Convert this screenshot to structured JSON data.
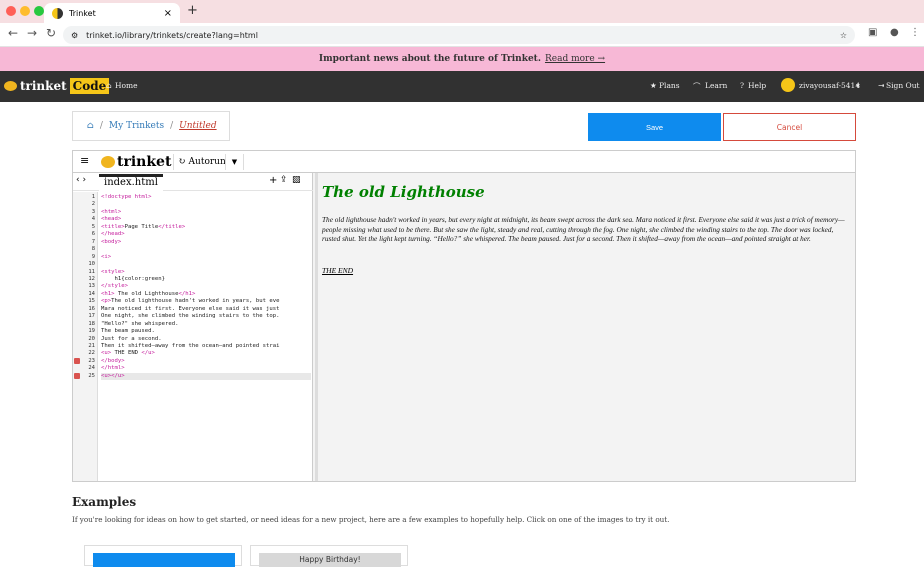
{
  "browser": {
    "tab_title": "Trinket",
    "new_tab_icon": "+",
    "url": "trinket.io/library/trinkets/create?lang=html",
    "traffic_lights": [
      "#ff5f57",
      "#febc2e",
      "#28c840"
    ]
  },
  "banner": {
    "text": "Important news about the future of Trinket.",
    "link": "Read more →"
  },
  "topnav": {
    "brand": "trinket",
    "brand_badge": "Code",
    "home": "Home",
    "plans": "Plans",
    "learn": "Learn",
    "help": "Help",
    "user": "zivayousaf-5414",
    "signout": "Sign Out"
  },
  "breadcrumb": {
    "library": "My Trinkets",
    "sep": "/",
    "current": "Untitled"
  },
  "actions": {
    "save": "Save",
    "cancel": "Cancel"
  },
  "ide": {
    "logo": "trinket",
    "autorun": "Autorun",
    "filename": "index.html",
    "line_numbers": [
      "1",
      "2",
      "3",
      "4",
      "5",
      "6",
      "7",
      "8",
      "9",
      "10",
      "11",
      "12",
      "13",
      "14",
      "15",
      "16",
      "17",
      "18",
      "19",
      "20",
      "21",
      "22",
      "23",
      "24",
      "25"
    ],
    "code": [
      "<!doctype html>",
      "",
      "<html>",
      "<head>",
      "<title>Page Title</title>",
      "</head>",
      "<body>",
      "",
      "<i>",
      "",
      "<style>",
      "    h1{color:green}",
      "</style>",
      "<h1> The old Lighthouse</h1>",
      "<p>The old lighthouse hadn't worked in years, but eve",
      "Mara noticed it first. Everyone else said it was just",
      "One night, she climbed the winding stairs to the top.",
      "\"Hello?\" she whispered.",
      "The beam paused.",
      "Just for a second.",
      "Then it shifted—away from the ocean—and pointed strai",
      "<u> THE END </u>",
      "</body>",
      "</html>",
      "<u></u>"
    ],
    "error_lines": [
      23,
      25
    ]
  },
  "preview": {
    "heading": "The old Lighthouse",
    "paragraph": "The old lighthouse hadn't worked in years, but every night at midnight, its beam swept across the dark sea. Mara noticed it first. Everyone else said it was just a trick of memory—people missing what used to be there. But she saw the light, steady and real, cutting through the fog. One night, she climbed the winding stairs to the top. The door was locked, rusted shut. Yet the light kept turning. “Hello?” she whispered. The beam paused. Just for a second. Then it shifted—away from the ocean—and pointed straight at her.",
    "end": "THE END"
  },
  "examples": {
    "title": "Examples",
    "description": "If you're looking for ideas on how to get started, or need ideas for a new project, here are a few examples to hopefully help. Click on one of the images to try it out.",
    "card2_text": "Happy Birthday!"
  }
}
